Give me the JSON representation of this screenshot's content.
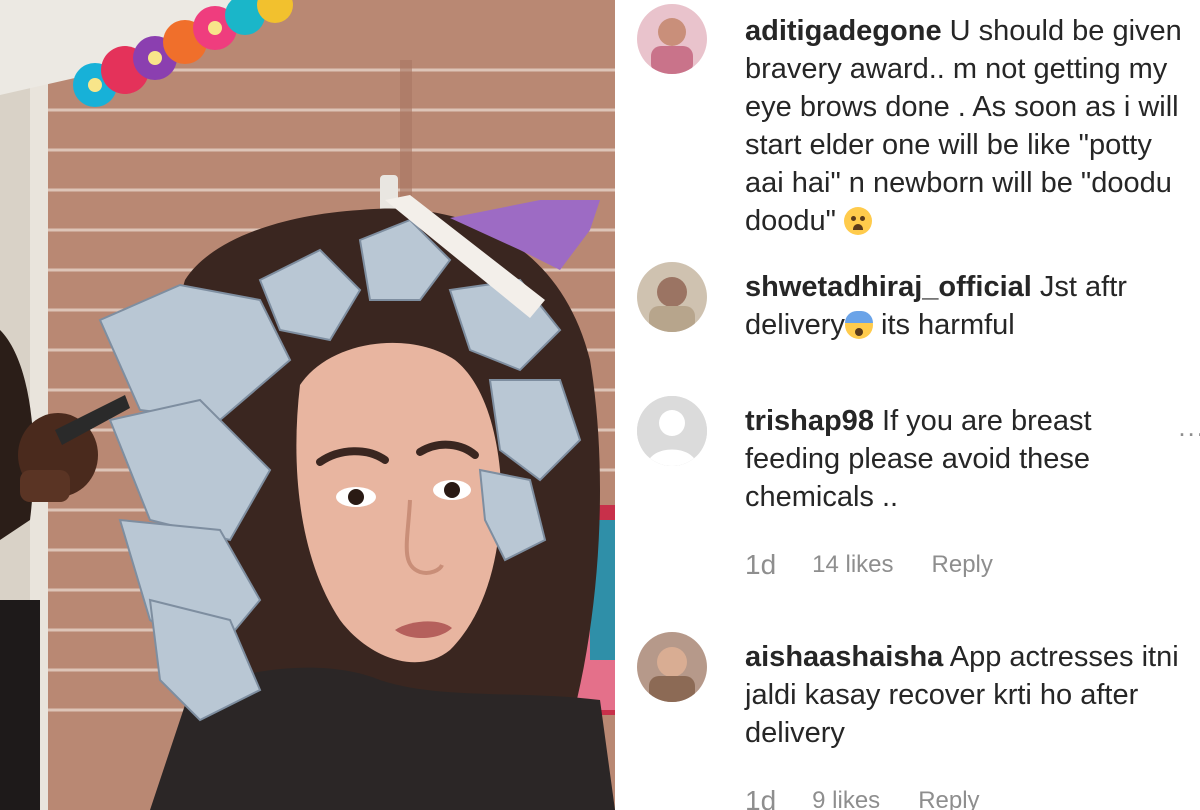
{
  "photo": {
    "alt_icon": "photo-of-woman-with-foil-hair-highlights"
  },
  "comments": [
    {
      "username": "aditigadegone",
      "text": "U should be given bravery award.. m not getting my eye brows done . As soon as i will start elder one will be like \"potty aai hai\" n newborn will be \"doodu doodu\"",
      "emoji_icon": "crying-face-emoji",
      "avatar_color": "#c9738a"
    },
    {
      "username": "shwetadhiraj_official",
      "text_before": "Jst aftr delivery",
      "emoji_icon": "fearful-face-emoji",
      "text_after": " its harmful",
      "avatar_color": "#b7a58c"
    },
    {
      "username": "trishap98",
      "text": "If you are breast feeding please avoid these chemicals ..",
      "time": "1d",
      "likes": "14 likes",
      "reply": "Reply",
      "more": "...",
      "avatar_color": "#d4d4d4"
    },
    {
      "username": "aishaashaisha",
      "text": "App actresses itni jaldi kasay recover krti ho after delivery",
      "time": "1d",
      "likes": "9 likes",
      "reply": "Reply",
      "avatar_color": "#8c6a55"
    }
  ]
}
